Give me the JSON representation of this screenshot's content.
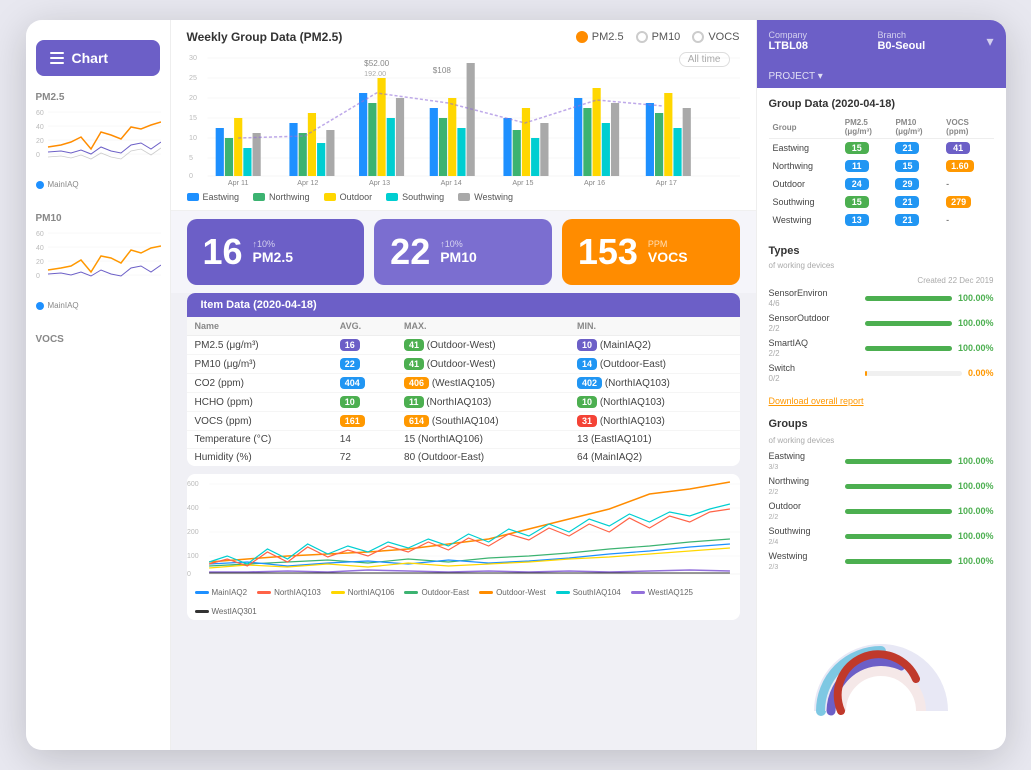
{
  "sidebar": {
    "chart_label": "Chart",
    "pm25_label": "PM2.5",
    "pm10_label": "PM10",
    "vocs_label": "VOCS"
  },
  "weekly_chart": {
    "title": "Weekly Group Data (PM2.5)",
    "all_time": "All time",
    "radio_pm25": "PM2.5",
    "radio_pm10": "PM10",
    "radio_vocs": "VOCS",
    "legend": [
      "Eastwing",
      "Northwing",
      "Outdoor",
      "Southwing",
      "Westwing"
    ],
    "legend_colors": [
      "#1e90ff",
      "#3cb371",
      "#ffd700",
      "#00ced1",
      "#a9a9a9"
    ],
    "dates": [
      "Apr 11",
      "Apr 12",
      "Apr 13",
      "Apr 14",
      "Apr 15",
      "Apr 16",
      "Apr 17"
    ],
    "annotation_1": "$52.00",
    "annotation_2": "192.00",
    "annotation_3": "$108"
  },
  "metrics": [
    {
      "value": "16",
      "prev": "↑10%",
      "label": "PM2.5",
      "type": "pm25"
    },
    {
      "value": "22",
      "prev": "↑10%",
      "label": "PM10",
      "type": "pm10"
    },
    {
      "value": "153",
      "prev": "PPM",
      "label": "VOCS",
      "type": "vocs"
    }
  ],
  "item_data": {
    "header": "Item Data (2020-04-18)",
    "columns": [
      "Name",
      "AVG.",
      "MAX.",
      "MIN."
    ],
    "rows": [
      {
        "name": "PM2.5 (μg/m³)",
        "avg": "16",
        "avg_color": "purple",
        "max": "41 (Outdoor-West)",
        "max_color": "green",
        "min": "10 (MainIAQ2)",
        "min_color": "purple"
      },
      {
        "name": "PM10 (μg/m³)",
        "avg": "22",
        "avg_color": "blue",
        "max": "41 (Outdoor-West)",
        "max_color": "green",
        "min": "14 (Outdoor-East)",
        "min_color": "blue"
      },
      {
        "name": "CO2 (ppm)",
        "avg": "404",
        "avg_color": "blue",
        "max": "406 (WestIAQ105)",
        "max_color": "orange",
        "min": "402 (NorthIAQ103)",
        "min_color": "blue"
      },
      {
        "name": "HCHO (ppm)",
        "avg": "10",
        "avg_color": "green",
        "max": "11 (NorthIAQ103)",
        "max_color": "green",
        "min": "10 (NorthIAQ103)",
        "min_color": "green"
      },
      {
        "name": "VOCS (ppm)",
        "avg": "161",
        "avg_color": "orange",
        "max": "614 (SouthIAQ104)",
        "max_color": "orange",
        "min": "31 (NorthIAQ103)",
        "min_color": "red"
      },
      {
        "name": "Temperature (°C)",
        "avg": "14",
        "avg_color": "none",
        "max": "15 (NorthIAQ106)",
        "max_color": "none",
        "min": "13 (EastIAQ101)",
        "min_color": "none"
      },
      {
        "name": "Humidity (%)",
        "avg": "72",
        "avg_color": "none",
        "max": "80 (Outdoor-East)",
        "max_color": "none",
        "min": "64 (MainIAQ2)",
        "min_color": "none"
      }
    ]
  },
  "right_panel": {
    "company_label": "Company",
    "branch_label": "Branch",
    "company_value": "LTBL08",
    "branch_value": "B0-Seoul",
    "project_label": "PROJECT ▾",
    "group_data_title": "Group Data (2020-04-18)",
    "group_columns": [
      "Group",
      "PM2.5 (μg/m³)",
      "PM10 (μg/m³)",
      "VOCS (ppm)"
    ],
    "groups": [
      {
        "name": "Eastwing",
        "pm25": "15",
        "pm25c": "green",
        "pm10": "21",
        "pm10c": "blue",
        "vocs": "41",
        "vocsc": "purple"
      },
      {
        "name": "Northwing",
        "pm25": "11",
        "pm25c": "blue",
        "pm10": "15",
        "pm10c": "blue",
        "vocs": "1.60",
        "vocsc": "orange"
      },
      {
        "name": "Outdoor",
        "pm25": "24",
        "pm25c": "blue",
        "pm10": "29",
        "pm10c": "blue",
        "vocs": "-",
        "vocsc": "none"
      },
      {
        "name": "Southwing",
        "pm25": "15",
        "pm25c": "green",
        "pm10": "21",
        "pm10c": "blue",
        "vocs": "279",
        "vocsc": "orange"
      },
      {
        "name": "Westwing",
        "pm25": "13",
        "pm25c": "blue",
        "pm10": "21",
        "pm10c": "blue",
        "vocs": "-",
        "vocsc": "none"
      }
    ],
    "types_title": "Types",
    "types_subtitle": "of working devices",
    "types": [
      {
        "name": "SensorEnviron",
        "count": "4/6",
        "pct": "100.00%",
        "color": "green"
      },
      {
        "name": "SensorOutdoor",
        "count": "2/2",
        "pct": "100.00%",
        "color": "green"
      },
      {
        "name": "SmartIAQ",
        "count": "2/2",
        "pct": "100.00%",
        "color": "green"
      },
      {
        "name": "Switch",
        "count": "0/2",
        "pct": "0.00%",
        "color": "orange"
      }
    ],
    "download_label": "Download overall report",
    "groups_title": "Groups",
    "groups_subtitle": "of working devices",
    "device_groups": [
      {
        "name": "Eastwing",
        "count": "3/3",
        "pct": "100.00%",
        "color": "green"
      },
      {
        "name": "Northwing",
        "count": "2/2",
        "pct": "100.00%",
        "color": "green"
      },
      {
        "name": "Outdoor",
        "count": "2/2",
        "pct": "100.00%",
        "color": "green"
      },
      {
        "name": "Southwing",
        "count": "2/4",
        "pct": "100.00%",
        "color": "green"
      },
      {
        "name": "Westwing",
        "count": "2/3",
        "pct": "100.00%",
        "color": "green"
      }
    ]
  },
  "vocs_chart": {
    "legend": [
      "MainIAQ2",
      "NorthIAQ103",
      "NorthIAQ106",
      "Outdoor-East",
      "Outdoor-West",
      "SouthIAQ104",
      "WestIAQ125",
      "WestIAQ301"
    ],
    "legend_colors": [
      "#1e90ff",
      "#ff6347",
      "#ffd700",
      "#3cb371",
      "#ff8c00",
      "#00ced1",
      "#9370db",
      "#333333"
    ]
  },
  "created_label": "Created",
  "created_date": "22 Dec 2019"
}
